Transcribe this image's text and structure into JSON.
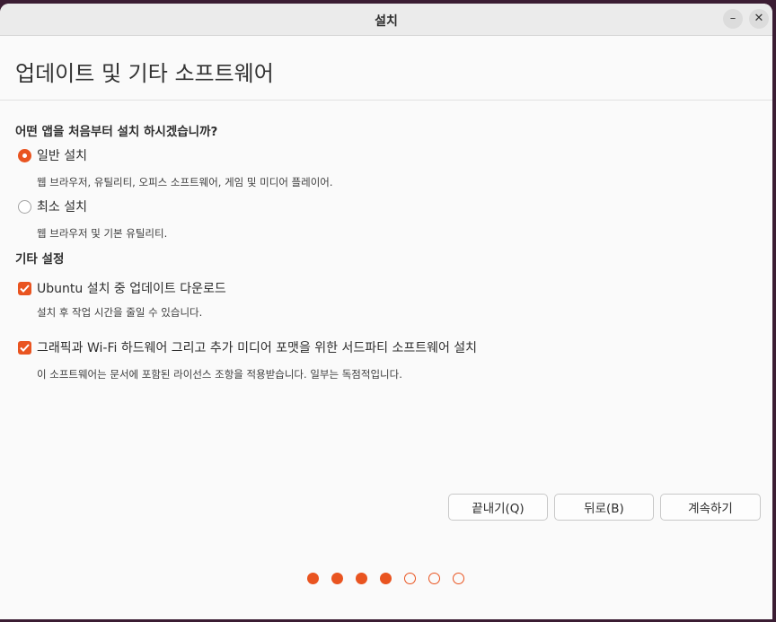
{
  "window": {
    "title": "설치",
    "minimize_label": "–",
    "close_label": "✕"
  },
  "page": {
    "title": "업데이트 및 기타 소프트웨어"
  },
  "apps_section": {
    "heading": "어떤 앱을 처음부터 설치 하시겠습니까?",
    "options": [
      {
        "label": "일반 설치",
        "description": "웹 브라우저, 유틸리티, 오피스  소프트웨어, 게임 및 미디어 플레이어.",
        "selected": true
      },
      {
        "label": "최소 설치",
        "description": "웹 브라우저 및 기본 유틸리티.",
        "selected": false
      }
    ]
  },
  "other_section": {
    "heading": "기타 설정",
    "checkboxes": [
      {
        "label": "Ubuntu 설치 중 업데이트 다운로드",
        "description": "설치 후 작업 시간을 줄일 수 있습니다.",
        "checked": true
      },
      {
        "label": "그래픽과 Wi-Fi 하드웨어 그리고 추가 미디어 포맷을 위한 서드파티 소프트웨어 설치",
        "description": "이 소프트웨어는 문서에 포함된 라이선스 조항을 적용받습니다. 일부는 독점적입니다.",
        "checked": true
      }
    ]
  },
  "buttons": {
    "quit": "끝내기(Q)",
    "back": "뒤로(B)",
    "continue": "계속하기"
  },
  "progress": {
    "total_steps": 7,
    "completed_steps": 4
  },
  "colors": {
    "accent": "#e95420",
    "background": "#fafafa",
    "titlebar": "#ebebeb",
    "desktop": "#3b1d33"
  }
}
